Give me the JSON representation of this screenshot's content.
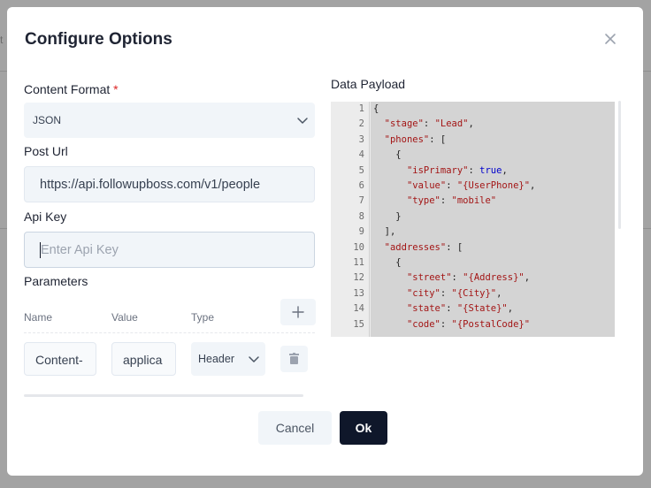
{
  "background": {
    "partial_text": "t"
  },
  "modal": {
    "title": "Configure Options"
  },
  "content_format": {
    "label": "Content Format",
    "required_mark": "*",
    "value": "JSON"
  },
  "post_url": {
    "label": "Post Url",
    "value": "https://api.followupboss.com/v1/people"
  },
  "api_key": {
    "label": "Api Key",
    "placeholder": "Enter Api Key",
    "value": ""
  },
  "parameters": {
    "label": "Parameters",
    "columns": [
      "Name",
      "Value",
      "Type"
    ],
    "rows": [
      {
        "name": "Content-",
        "value": "applica",
        "type": "Header"
      }
    ]
  },
  "payload": {
    "label": "Data Payload",
    "lines": [
      {
        "n": "1",
        "tokens": [
          {
            "t": "{",
            "c": "p"
          }
        ]
      },
      {
        "n": "2",
        "tokens": [
          {
            "t": "  ",
            "c": "p"
          },
          {
            "t": "\"stage\"",
            "c": "k"
          },
          {
            "t": ": ",
            "c": "p"
          },
          {
            "t": "\"Lead\"",
            "c": "s"
          },
          {
            "t": ",",
            "c": "p"
          }
        ]
      },
      {
        "n": "3",
        "tokens": [
          {
            "t": "  ",
            "c": "p"
          },
          {
            "t": "\"phones\"",
            "c": "k"
          },
          {
            "t": ": [",
            "c": "p"
          }
        ]
      },
      {
        "n": "4",
        "tokens": [
          {
            "t": "    {",
            "c": "p"
          }
        ]
      },
      {
        "n": "5",
        "tokens": [
          {
            "t": "      ",
            "c": "p"
          },
          {
            "t": "\"isPrimary\"",
            "c": "k"
          },
          {
            "t": ": ",
            "c": "p"
          },
          {
            "t": "true",
            "c": "b"
          },
          {
            "t": ",",
            "c": "p"
          }
        ]
      },
      {
        "n": "6",
        "tokens": [
          {
            "t": "      ",
            "c": "p"
          },
          {
            "t": "\"value\"",
            "c": "k"
          },
          {
            "t": ": ",
            "c": "p"
          },
          {
            "t": "\"{UserPhone}\"",
            "c": "s"
          },
          {
            "t": ",",
            "c": "p"
          }
        ]
      },
      {
        "n": "7",
        "tokens": [
          {
            "t": "      ",
            "c": "p"
          },
          {
            "t": "\"type\"",
            "c": "k"
          },
          {
            "t": ": ",
            "c": "p"
          },
          {
            "t": "\"mobile\"",
            "c": "s"
          }
        ]
      },
      {
        "n": "8",
        "tokens": [
          {
            "t": "    }",
            "c": "p"
          }
        ]
      },
      {
        "n": "9",
        "tokens": [
          {
            "t": "  ],",
            "c": "p"
          }
        ]
      },
      {
        "n": "10",
        "tokens": [
          {
            "t": "  ",
            "c": "p"
          },
          {
            "t": "\"addresses\"",
            "c": "k"
          },
          {
            "t": ": [",
            "c": "p"
          }
        ]
      },
      {
        "n": "11",
        "tokens": [
          {
            "t": "    {",
            "c": "p"
          }
        ]
      },
      {
        "n": "12",
        "tokens": [
          {
            "t": "      ",
            "c": "p"
          },
          {
            "t": "\"street\"",
            "c": "k"
          },
          {
            "t": ": ",
            "c": "p"
          },
          {
            "t": "\"{Address}\"",
            "c": "s"
          },
          {
            "t": ",",
            "c": "p"
          }
        ]
      },
      {
        "n": "13",
        "tokens": [
          {
            "t": "      ",
            "c": "p"
          },
          {
            "t": "\"city\"",
            "c": "k"
          },
          {
            "t": ": ",
            "c": "p"
          },
          {
            "t": "\"{City}\"",
            "c": "s"
          },
          {
            "t": ",",
            "c": "p"
          }
        ]
      },
      {
        "n": "14",
        "tokens": [
          {
            "t": "      ",
            "c": "p"
          },
          {
            "t": "\"state\"",
            "c": "k"
          },
          {
            "t": ": ",
            "c": "p"
          },
          {
            "t": "\"{State}\"",
            "c": "s"
          },
          {
            "t": ",",
            "c": "p"
          }
        ]
      },
      {
        "n": "15",
        "tokens": [
          {
            "t": "      ",
            "c": "p"
          },
          {
            "t": "\"code\"",
            "c": "k"
          },
          {
            "t": ": ",
            "c": "p"
          },
          {
            "t": "\"{PostalCode}\"",
            "c": "s"
          }
        ]
      }
    ]
  },
  "footer": {
    "cancel_label": "Cancel",
    "ok_label": "Ok"
  },
  "icons": {
    "close": "close-icon",
    "chevron": "chevron-down-icon",
    "add": "plus-icon",
    "delete": "trash-icon"
  },
  "colors": {
    "primary_button": "#0f172a",
    "required": "#dc2626",
    "json_key": "#a31515",
    "json_bool": "#0000cc"
  }
}
